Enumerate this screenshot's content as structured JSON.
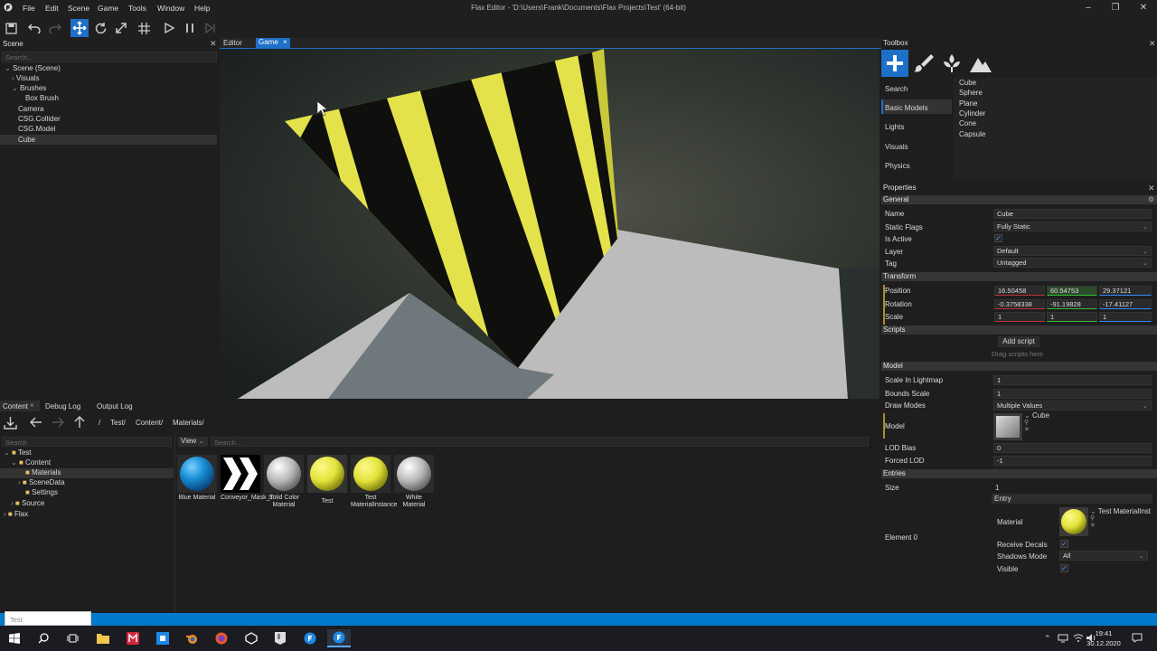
{
  "menu": {
    "items": [
      "File",
      "Edit",
      "Scene",
      "Game",
      "Tools",
      "Window",
      "Help"
    ]
  },
  "window": {
    "title": "Flax Editor - 'D:\\Users\\Frank\\Documents\\Flax Projects\\Test' (64-bit)"
  },
  "scene_panel": {
    "title": "Scene",
    "search_placeholder": "Search...",
    "tree": [
      "Scene (Scene)",
      "Visuals",
      "Brushes",
      "Box Brush",
      "Camera",
      "CSG.Collider",
      "CSG.Model",
      "Cube"
    ]
  },
  "viewport": {
    "tabs": [
      "Editor",
      "Game"
    ],
    "active_tab": "Game"
  },
  "content_panel": {
    "tabs": [
      "Content",
      "Debug Log",
      "Output Log"
    ],
    "breadcrumb": [
      "/",
      "Test/",
      "Content/",
      "Materials/"
    ],
    "tree_search": "Search",
    "tree": [
      "Test",
      "Content",
      "Materials",
      "SceneData",
      "Settings",
      "Source",
      "Flax"
    ],
    "view_label": "View",
    "grid_search": "Search...",
    "assets": [
      "Blue Material",
      "Conveyor_Mask_T",
      "Solid Color Material",
      "Test",
      "Test MaterialInstance",
      "White Material"
    ]
  },
  "toolbox": {
    "title": "Toolbox",
    "categories": [
      "Search",
      "Basic Models",
      "Lights",
      "Visuals",
      "Physics"
    ],
    "active_category": "Basic Models",
    "items": [
      "Cube",
      "Sphere",
      "Plane",
      "Cylinder",
      "Cone",
      "Capsule"
    ]
  },
  "properties": {
    "title": "Properties",
    "general": {
      "header": "General",
      "name_label": "Name",
      "name": "Cube",
      "static_flags_label": "Static Flags",
      "static_flags": "Fully Static",
      "is_active_label": "Is Active",
      "layer_label": "Layer",
      "layer": "Default",
      "tag_label": "Tag",
      "tag": "Untagged"
    },
    "transform": {
      "header": "Transform",
      "position_label": "Position",
      "position": [
        "16.50458",
        "60.54753",
        "29.37121"
      ],
      "rotation_label": "Rotation",
      "rotation": [
        "-0.3758338",
        "-91.19828",
        "-17.41127"
      ],
      "scale_label": "Scale",
      "scale": [
        "1",
        "1",
        "1"
      ]
    },
    "scripts": {
      "header": "Scripts",
      "add_label": "Add script",
      "hint": "Drag scripts here"
    },
    "model": {
      "header": "Model",
      "scale_lightmap_label": "Scale In Lightmap",
      "scale_lightmap": "1",
      "bounds_scale_label": "Bounds Scale",
      "bounds_scale": "1",
      "draw_modes_label": "Draw Modes",
      "draw_modes": "Multiple Values",
      "model_label": "Model",
      "model": "Cube",
      "lod_bias_label": "LOD Bias",
      "lod_bias": "0",
      "forced_lod_label": "Forced LOD",
      "forced_lod": "-1"
    },
    "entries": {
      "header": "Entries",
      "size_label": "Size",
      "size": "1",
      "entry_label": "Entry",
      "element_label": "Element 0",
      "material_label": "Material",
      "material": "Test MaterialInst",
      "receive_decals_label": "Receive Decals",
      "shadows_mode_label": "Shadows Mode",
      "shadows_mode": "All",
      "visible_label": "Visible"
    }
  },
  "statusbar": {
    "rename_value": "Test"
  },
  "taskbar": {
    "time": "19:41",
    "date": "30.12.2020"
  },
  "colors": {
    "accent": "#1e6fc7",
    "status": "#007acc",
    "cube_yellow": "#e3e24a"
  }
}
